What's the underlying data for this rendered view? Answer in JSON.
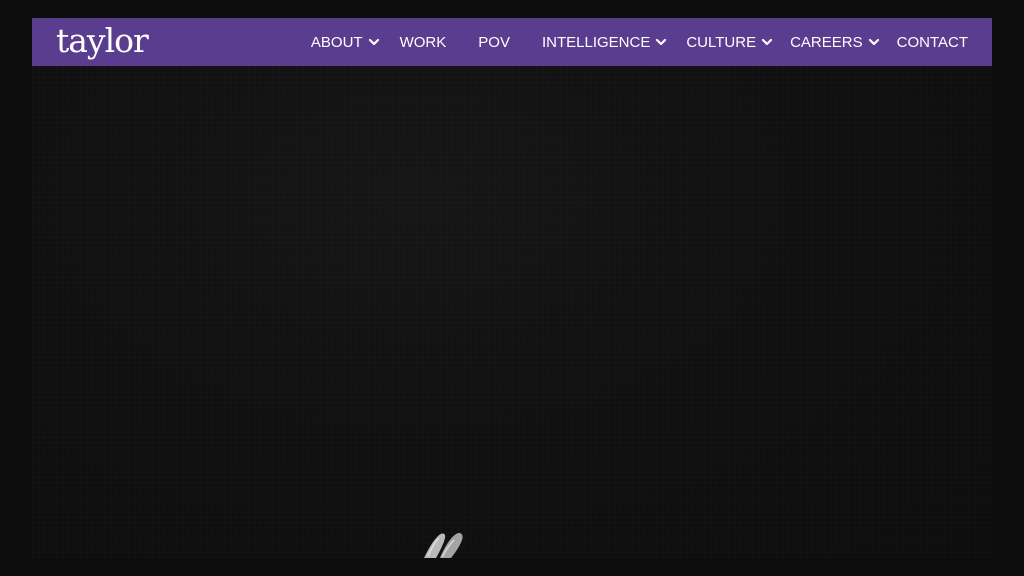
{
  "brand": {
    "logo_text": "taylor",
    "nav_color": "#5a3d8e"
  },
  "nav": {
    "items": [
      {
        "label": "ABOUT",
        "has_dropdown": true
      },
      {
        "label": "WORK",
        "has_dropdown": false
      },
      {
        "label": "POV",
        "has_dropdown": false
      },
      {
        "label": "INTELLIGENCE",
        "has_dropdown": true
      },
      {
        "label": "CULTURE",
        "has_dropdown": true
      },
      {
        "label": "CAREERS",
        "has_dropdown": true
      },
      {
        "label": "CONTACT",
        "has_dropdown": false
      }
    ],
    "dropdown_icon": "chevron-down-icon"
  },
  "hero": {
    "background_color": "#111112",
    "image_subject": "hand-icon"
  }
}
